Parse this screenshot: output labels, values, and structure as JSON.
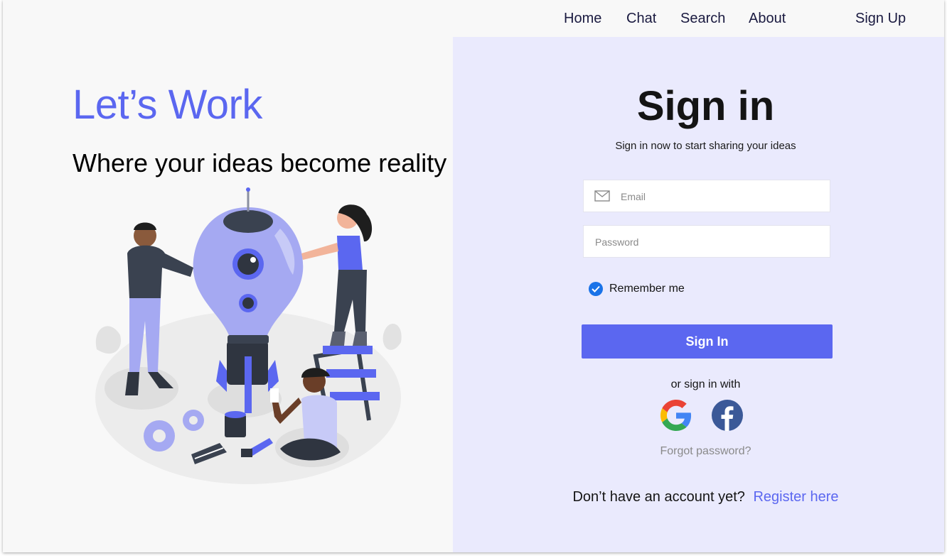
{
  "nav": {
    "items": [
      {
        "label": "Home"
      },
      {
        "label": "Chat"
      },
      {
        "label": "Search"
      },
      {
        "label": "About"
      }
    ],
    "signup_label": "Sign Up"
  },
  "hero": {
    "title": "Let’s Work",
    "subtitle": "Where your ideas become reality",
    "illustration_icon": "team-building-rocket-illustration"
  },
  "signin": {
    "title": "Sign in",
    "subtitle": "Sign in now to start sharing your ideas",
    "email": {
      "placeholder": "Email",
      "value": "",
      "icon": "mail-icon"
    },
    "password": {
      "placeholder": "Password",
      "value": ""
    },
    "remember": {
      "label": "Remember me",
      "checked": true
    },
    "button_label": "Sign In",
    "social_text": "or sign in with",
    "social": [
      {
        "name": "google",
        "icon": "google-icon"
      },
      {
        "name": "facebook",
        "icon": "facebook-icon"
      }
    ],
    "forgot_label": "Forgot password?",
    "register_question": "Don’t have an account yet?",
    "register_link": "Register here"
  },
  "colors": {
    "accent": "#5b67f0",
    "panel_bg": "#eaeafd",
    "page_bg": "#f8f8f8",
    "check": "#1a73e8",
    "facebook": "#3b5998"
  }
}
